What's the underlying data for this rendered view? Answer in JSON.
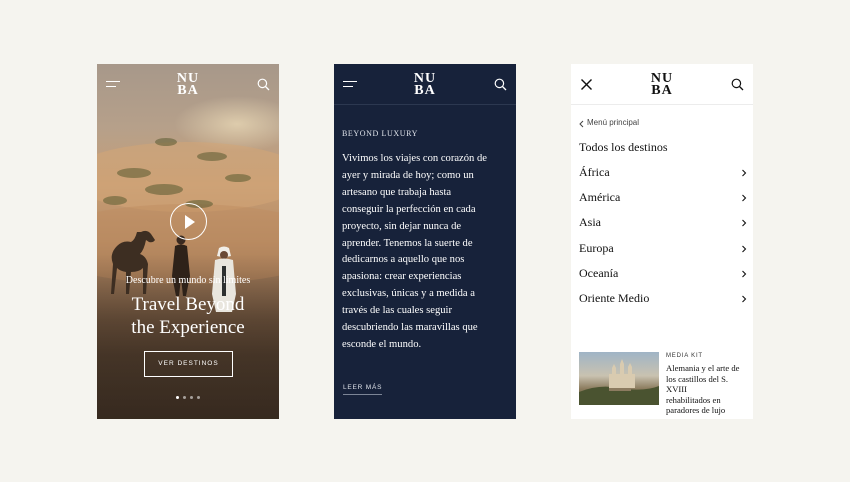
{
  "brand": {
    "logo_line1": "NU",
    "logo_line2": "BA"
  },
  "hero": {
    "subtitle": "Descubre un mundo sin límites",
    "title_line1": "Travel Beyond",
    "title_line2": "the Experience",
    "cta_label": "VER DESTINOS",
    "slide_count": 4,
    "active_slide": 1
  },
  "about": {
    "eyebrow": "BEYOND LUXURY",
    "lines": [
      "Vivimos los viajes con corazón de",
      "ayer y mirada de hoy; como un",
      "artesano que trabaja hasta",
      "conseguir la perfección en cada",
      "proyecto, sin dejar nunca de",
      "aprender. Tenemos la suerte de",
      "dedicarnos a aquello que nos",
      "apasiona: crear experiencias",
      "exclusivas, únicas y a medida a",
      "través de las cuales seguir",
      "descubriendo las maravillas que",
      "esconde el mundo."
    ],
    "read_more": "LEER MÁS"
  },
  "menu": {
    "back_label": "Menú principal",
    "all_destinations": "Todos los destinos",
    "items": [
      {
        "label": "África"
      },
      {
        "label": "América"
      },
      {
        "label": "Asia"
      },
      {
        "label": "Europa"
      },
      {
        "label": "Oceanía"
      },
      {
        "label": "Oriente Medio"
      }
    ],
    "media_kit": {
      "label": "MEDIA KIT",
      "title_lines": [
        "Alemania y el arte de",
        "los castillos del S. XVIII",
        "rehabilitados en",
        "paradores de lujo"
      ]
    }
  },
  "colors": {
    "page_bg": "#f5f4ef",
    "navy": "#17223a",
    "white": "#ffffff",
    "text_dark": "#111111"
  }
}
